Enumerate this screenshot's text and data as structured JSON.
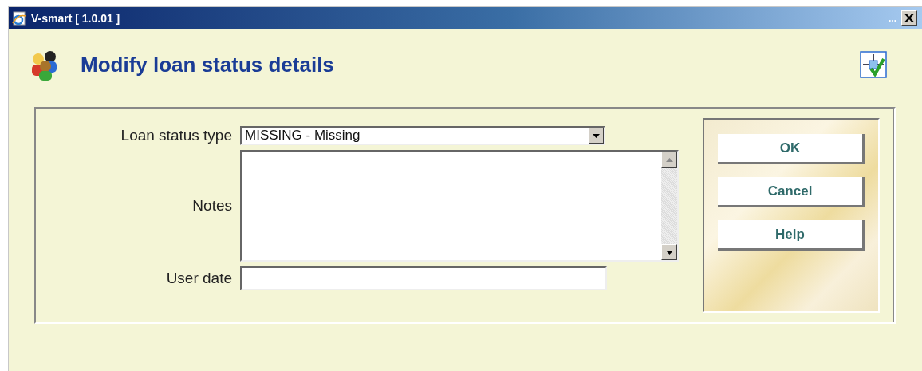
{
  "window": {
    "title": "V-smart [ 1.0.01 ]",
    "title_extra": "..."
  },
  "heading": "Modify loan status details",
  "form": {
    "fields": [
      {
        "kind": "select",
        "label": "Loan status type",
        "value": "MISSING - Missing"
      },
      {
        "kind": "textarea",
        "label": "Notes"
      },
      {
        "kind": "text",
        "label": "User date"
      }
    ]
  },
  "buttons": [
    "OK",
    "Cancel",
    "Help"
  ]
}
